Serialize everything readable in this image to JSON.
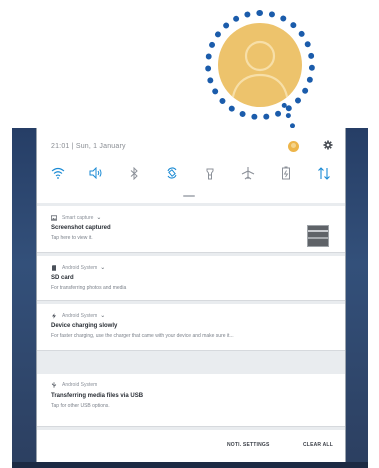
{
  "callout": {
    "icon": "user-avatar-icon",
    "border_color": "#1b5cab",
    "avatar_color": "#edc36c"
  },
  "status": {
    "time_date": "21:01 | Sun, 1 January",
    "avatar_icon": "user-avatar-icon",
    "settings_icon": "gear-icon"
  },
  "quick_settings": [
    {
      "name": "wifi",
      "icon": "wifi-icon",
      "active": true
    },
    {
      "name": "sound",
      "icon": "speaker-icon",
      "active": true
    },
    {
      "name": "bluetooth",
      "icon": "bluetooth-icon",
      "active": false
    },
    {
      "name": "auto-rotate",
      "icon": "rotate-icon",
      "active": true
    },
    {
      "name": "flashlight",
      "icon": "flashlight-icon",
      "active": false
    },
    {
      "name": "airplane-mode",
      "icon": "airplane-icon",
      "active": false
    },
    {
      "name": "power-saving",
      "icon": "battery-icon",
      "active": false
    },
    {
      "name": "mobile-data",
      "icon": "data-arrows-icon",
      "active": true
    }
  ],
  "notifications": [
    {
      "app": "Smart capture",
      "icon": "image-icon",
      "title": "Screenshot captured",
      "subtitle": "Tap here to view it.",
      "has_thumbnail": true
    },
    {
      "app": "Android System",
      "icon": "sd-card-icon",
      "title": "SD card",
      "subtitle": "For transferring photos and media",
      "has_thumbnail": false
    },
    {
      "app": "Android System",
      "icon": "charging-bolt-icon",
      "title": "Device charging slowly",
      "subtitle": "For faster charging, use the charger that came with your device and make sure it...",
      "has_thumbnail": false
    },
    {
      "app": "Android System",
      "icon": "usb-icon",
      "title": "Transferring media files via USB",
      "subtitle": "Tap for other USB options.",
      "has_thumbnail": false
    }
  ],
  "actions": {
    "notification_settings": "NOTI. SETTINGS",
    "clear_all": "CLEAR ALL"
  },
  "colors": {
    "accent": "#1a8ad4",
    "panel_bg": "#e9ecef",
    "wallpaper": "#2c4266"
  }
}
